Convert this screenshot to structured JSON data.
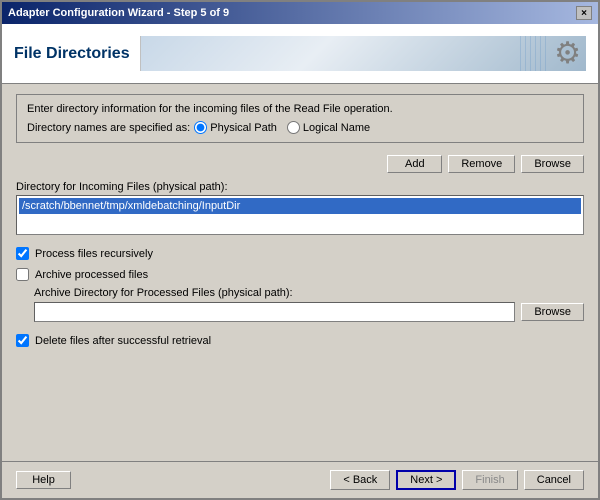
{
  "window": {
    "title": "Adapter Configuration Wizard - Step 5 of 9",
    "close_label": "×"
  },
  "header": {
    "title": "File Directories",
    "gear_icon": "⚙"
  },
  "info": {
    "description": "Enter directory information for the incoming files of the Read File operation.",
    "radio_prefix": "Directory names are specified as:",
    "radio_physical": "Physical Path",
    "radio_logical": "Logical Name"
  },
  "buttons": {
    "add": "Add",
    "remove": "Remove",
    "browse": "Browse",
    "browse_archive": "Browse"
  },
  "directory": {
    "label": "Directory for Incoming Files (physical path):",
    "value": "/scratch/bbennet/tmp/xmldebatching/InputDir"
  },
  "options": {
    "process_recursive_label": "Process files recursively",
    "process_recursive_checked": true,
    "archive_label": "Archive processed files",
    "archive_checked": false,
    "archive_path_label": "Archive Directory for Processed Files (physical path):",
    "archive_path_value": "",
    "delete_label": "Delete files after successful retrieval",
    "delete_checked": true
  },
  "footer": {
    "help": "Help",
    "back": "< Back",
    "next": "Next >",
    "finish": "Finish",
    "cancel": "Cancel"
  }
}
